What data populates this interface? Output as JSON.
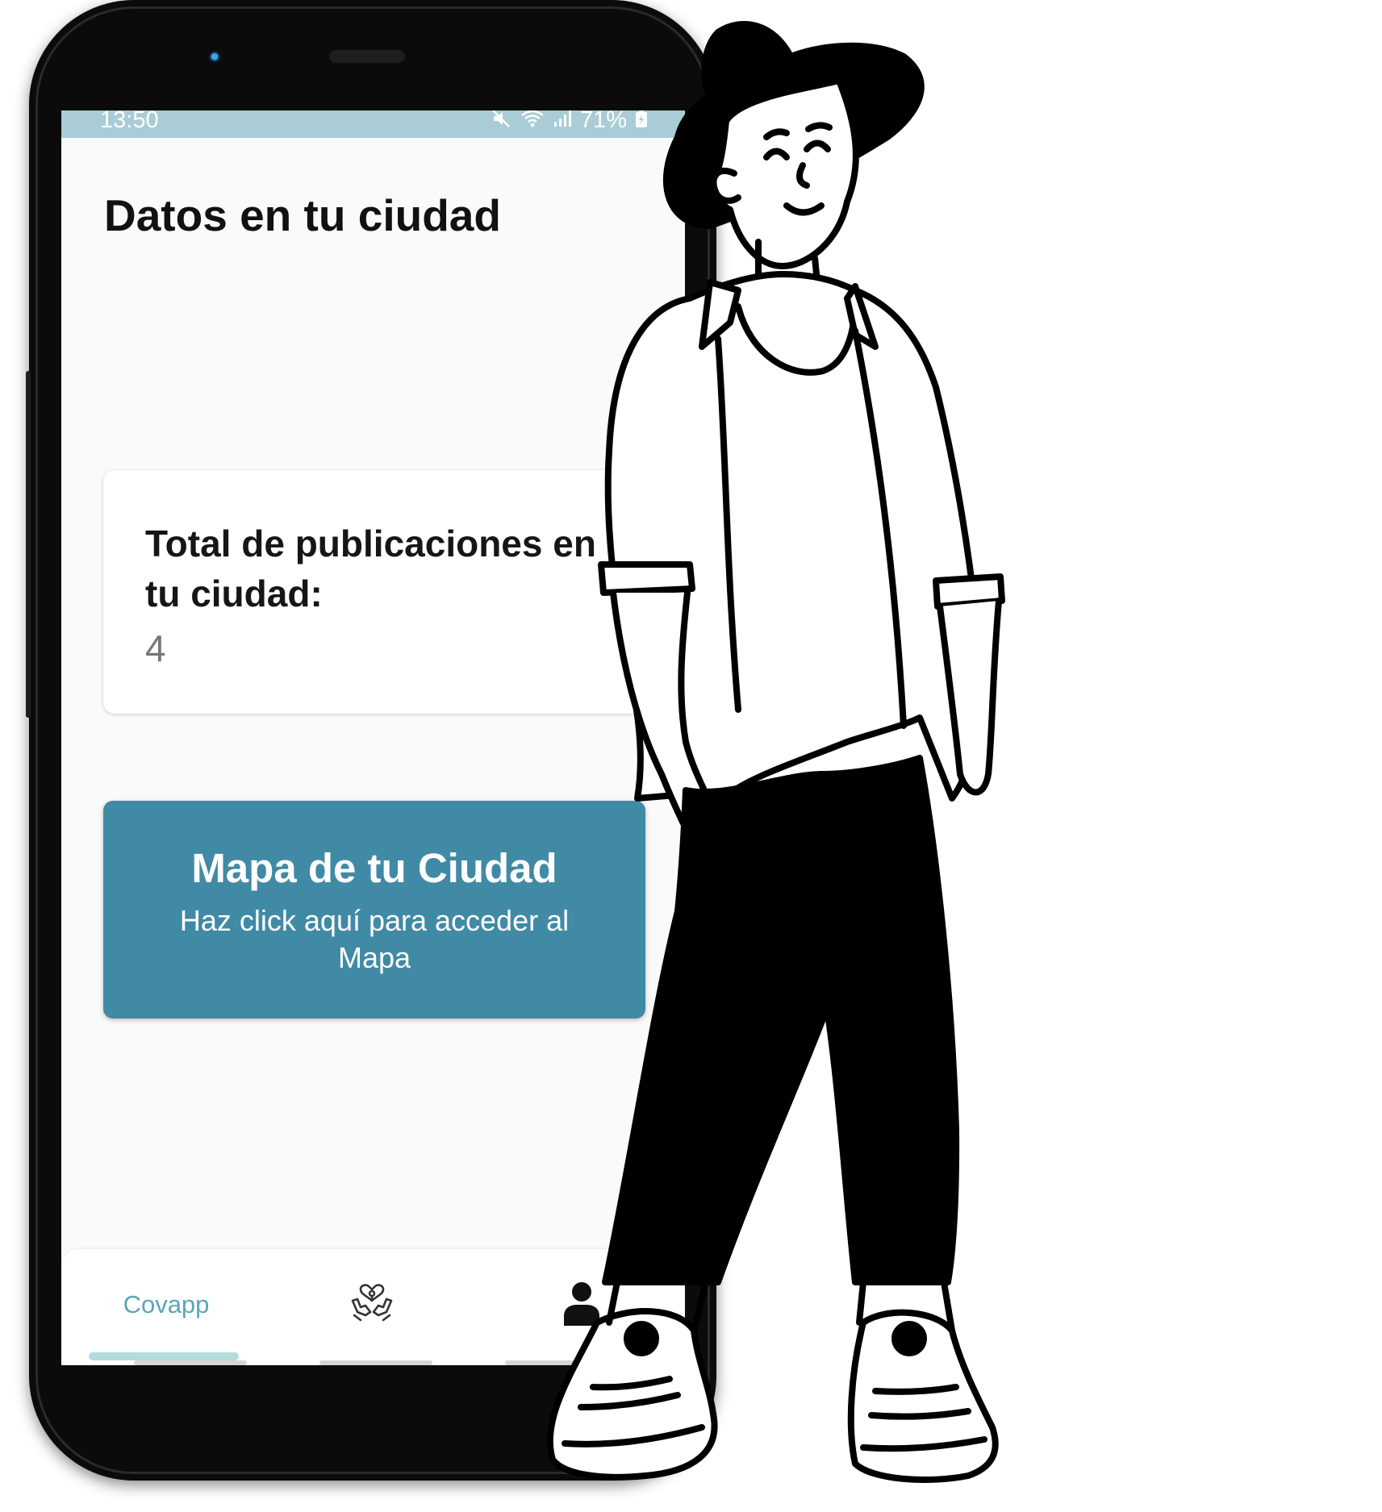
{
  "status_bar": {
    "time": "13:50",
    "battery": "71%",
    "icons": [
      "mute-icon",
      "wifi-icon",
      "signal-icon",
      "battery-charging-icon"
    ]
  },
  "page": {
    "title": "Datos en tu ciudad"
  },
  "stat_card": {
    "label": "Total de publicaciones en tu ciudad:",
    "value": "4"
  },
  "map_button": {
    "title": "Mapa de tu Ciudad",
    "subtitle": "Haz click aquí para acceder al Mapa"
  },
  "bottom_nav": {
    "items": [
      {
        "label": "Covapp",
        "active": true
      },
      {
        "icon": "helping-hands-heart-icon"
      },
      {
        "icon": "user-icon"
      }
    ]
  },
  "colors": {
    "status_bar": "#a9ccd6",
    "accent": "#418aa6",
    "nav_active": "#5aa6b7",
    "nav_indicator": "#b3dcdc"
  }
}
